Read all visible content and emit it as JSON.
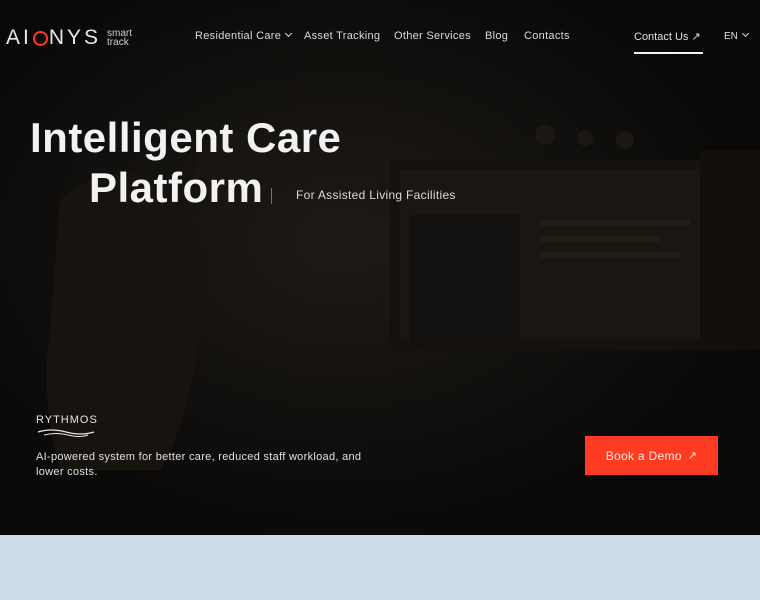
{
  "header": {
    "logo_text_left": "AI",
    "logo_text_right": "NYS",
    "logo_sub_line1": "smart",
    "logo_sub_line2": "track",
    "nav": [
      {
        "label": "Residential Care",
        "has_dropdown": true
      },
      {
        "label": "Asset Tracking"
      },
      {
        "label": "Other Services"
      },
      {
        "label": "Blog"
      },
      {
        "label": "Contacts"
      }
    ],
    "contact_label": "Contact Us",
    "language": "EN"
  },
  "hero": {
    "title_line1": "Intelligent Care",
    "title_line2": "Platform",
    "subtitle": "For Assisted Living Facilities",
    "product_logo": "RYTHMOS",
    "description": "AI-powered system for better care, reduced staff workload, and lower costs.",
    "cta_label": "Book a Demo"
  },
  "colors": {
    "accent": "#ff3b22",
    "hero_bg": "#0b0b0b",
    "below_bg": "#cfdde9"
  }
}
